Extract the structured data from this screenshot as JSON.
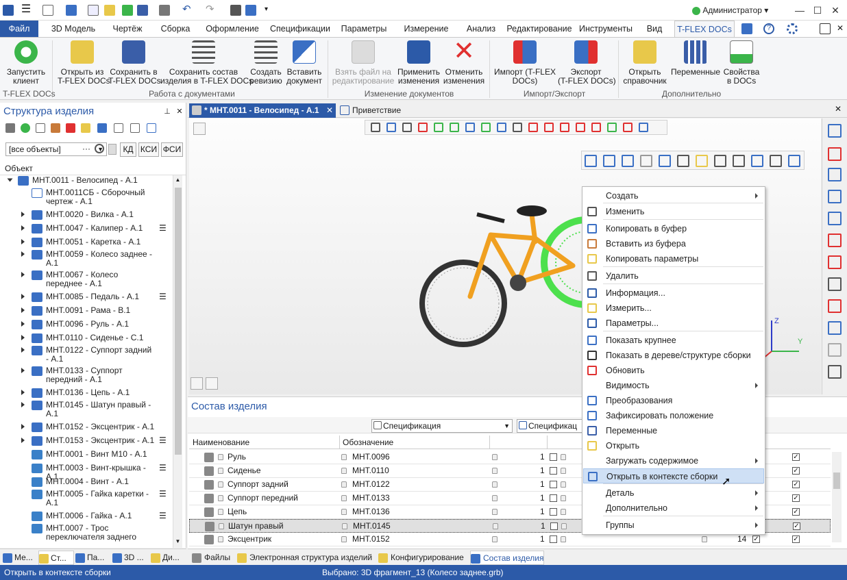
{
  "app": {
    "user": "Администратор"
  },
  "ribbon_tabs": [
    "Файл",
    "3D Модель",
    "Чертёж",
    "Сборка",
    "Оформление",
    "Спецификации",
    "Параметры",
    "Измерение",
    "Анализ",
    "Редактирование",
    "Инструменты",
    "Вид",
    "T-FLEX DOCs"
  ],
  "ribbon": {
    "buttons": [
      {
        "label1": "Запустить",
        "label2": "клиент",
        "color": "#3bb54a"
      },
      {
        "label1": "Открыть из",
        "label2": "T-FLEX DOCs",
        "color": "#e8c84a"
      },
      {
        "label1": "Сохранить в",
        "label2": "T-FLEX DOCs",
        "color": "#3a5ea8"
      },
      {
        "label1": "Сохранить состав",
        "label2": "изделия в T-FLEX DOCs",
        "color": "#555555"
      },
      {
        "label1": "Создать",
        "label2": "ревизию",
        "color": "#555555"
      },
      {
        "label1": "Вставить",
        "label2": "документ",
        "color": "#3a6fc4"
      },
      {
        "label1": "Взять файл на",
        "label2": "редактирование",
        "color": "#bbbbbb"
      },
      {
        "label1": "Применить",
        "label2": "изменения",
        "color": "#2c5aa8"
      },
      {
        "label1": "Отменить",
        "label2": "изменения",
        "color": "#e03030"
      },
      {
        "label1": "Импорт (T-FLEX",
        "label2": "DOCs)",
        "color": "#3a6fc4"
      },
      {
        "label1": "Экспорт",
        "label2": "(T-FLEX DOCs)",
        "color": "#3a6fc4"
      },
      {
        "label1": "Открыть",
        "label2": "справочник",
        "color": "#e8c84a"
      },
      {
        "label1": "Переменные",
        "label2": "",
        "color": "#3a5ea8"
      },
      {
        "label1": "Свойства",
        "label2": "в DOCs",
        "color": "#3bb54a"
      }
    ],
    "groups": [
      "T-FLEX DOCs",
      "Работа с документами",
      "Изменение документов",
      "Импорт/Экспорт",
      "Дополнительно"
    ]
  },
  "left_panel": {
    "title": "Структура изделия",
    "filter_value": "[все объекты]",
    "filter_buttons": [
      "КД",
      "КСИ",
      "ФСИ"
    ],
    "column": "Объект",
    "tree": [
      {
        "label": "МНТ.0011 - Велосипед - А.1"
      },
      {
        "label": "МНТ.0011СБ - Сборочный чертеж - А.1"
      },
      {
        "label": "МНТ.0020 - Вилка - А.1"
      },
      {
        "label": "МНТ.0047 - Калипер - А.1"
      },
      {
        "label": "МНТ.0051 - Каретка - А.1"
      },
      {
        "label": "МНТ.0059 - Колесо заднее - А.1"
      },
      {
        "label": "МНТ.0067 - Колесо переднее - А.1"
      },
      {
        "label": "МНТ.0085 - Педаль - А.1"
      },
      {
        "label": "МНТ.0091 - Рама - В.1"
      },
      {
        "label": "МНТ.0096 - Руль - А.1"
      },
      {
        "label": "МНТ.0110 - Сиденье - С.1"
      },
      {
        "label": "МНТ.0122 - Суппорт задний - А.1"
      },
      {
        "label": "МНТ.0133 - Суппорт передний - А.1"
      },
      {
        "label": "МНТ.0136 - Цепь - А.1"
      },
      {
        "label": "МНТ.0145 - Шатун правый - А.1"
      },
      {
        "label": "МНТ.0152 - Эксцентрик - А.1"
      },
      {
        "label": "МНТ.0153 - Эксцентрик - А.1"
      },
      {
        "label": "МНТ.0001 - Винт М10 - А.1"
      },
      {
        "label": "МНТ.0003 - Винт-крышка - А.1"
      },
      {
        "label": "МНТ.0004 - Винт - А.1"
      },
      {
        "label": "МНТ.0005 - Гайка каретки - А.1"
      },
      {
        "label": "МНТ.0006 - Гайка - А.1"
      },
      {
        "label": "МНТ.0007 - Трос переключателя заднего"
      }
    ]
  },
  "doc_tabs": [
    "* МНТ.0011 - Велосипед - А.1",
    "Приветствие"
  ],
  "bottom_panel": {
    "title": "Состав изделия",
    "combo1": "Спецификация",
    "combo2": "Спецификац",
    "columns": [
      "Наименование",
      "Обозначение"
    ],
    "rows": [
      {
        "name": "Руль",
        "code": "МНТ.0096",
        "qty": "1"
      },
      {
        "name": "Сиденье",
        "code": "МНТ.0110",
        "qty": "1"
      },
      {
        "name": "Суппорт задний",
        "code": "МНТ.0122",
        "qty": "1"
      },
      {
        "name": "Суппорт передний",
        "code": "МНТ.0133",
        "qty": "1"
      },
      {
        "name": "Цепь",
        "code": "МНТ.0136",
        "qty": "1"
      },
      {
        "name": "Шатун правый",
        "code": "МНТ.0145",
        "qty": "1"
      },
      {
        "name": "Эксцентрик",
        "code": "МНТ.0152",
        "qty": "1"
      }
    ],
    "last_row_right_qty": "14"
  },
  "context_menu": [
    {
      "label": "Создать",
      "sub": true,
      "icon": "none"
    },
    {
      "label": "Изменить",
      "sub": false,
      "icon": "edit-icon"
    },
    {
      "label": "Копировать в буфер",
      "sub": false,
      "icon": "copy-icon"
    },
    {
      "label": "Вставить из буфера",
      "sub": false,
      "icon": "paste-icon"
    },
    {
      "label": "Копировать параметры",
      "sub": false,
      "icon": "copy-params-icon"
    },
    {
      "label": "Удалить",
      "sub": false,
      "icon": "trash-icon"
    },
    {
      "label": "Информация...",
      "sub": false,
      "icon": "info-icon"
    },
    {
      "label": "Измерить...",
      "sub": false,
      "icon": "measure-icon"
    },
    {
      "label": "Параметры...",
      "sub": false,
      "icon": "params-icon"
    },
    {
      "label": "Показать крупнее",
      "sub": false,
      "icon": "zoom-icon"
    },
    {
      "label": "Показать в дереве/структуре сборки",
      "sub": false,
      "icon": "target-icon"
    },
    {
      "label": "Обновить",
      "sub": false,
      "icon": "refresh-icon"
    },
    {
      "label": "Видимость",
      "sub": true,
      "icon": "none"
    },
    {
      "label": "Преобразования",
      "sub": false,
      "icon": "transform-icon"
    },
    {
      "label": "Зафиксировать положение",
      "sub": false,
      "icon": "pin-icon"
    },
    {
      "label": "Переменные",
      "sub": false,
      "icon": "variables-icon"
    },
    {
      "label": "Открыть",
      "sub": false,
      "icon": "folder-icon"
    },
    {
      "label": "Загружать содержимое",
      "sub": true,
      "icon": "none"
    },
    {
      "label": "Открыть в контексте сборки",
      "sub": false,
      "icon": "context-icon"
    },
    {
      "label": "Деталь",
      "sub": true,
      "icon": "none"
    },
    {
      "label": "Дополнительно",
      "sub": true,
      "icon": "none"
    },
    {
      "label": "Группы",
      "sub": true,
      "icon": "none"
    }
  ],
  "bottom_tabs_left": [
    "Ме...",
    "Ст...",
    "Па...",
    "3D ...",
    "Ди..."
  ],
  "bottom_tabs_right": [
    "Файлы",
    "Электронная структура изделий",
    "Конфигурирование",
    "Состав изделия"
  ],
  "status": {
    "left": "Открыть в контексте сборки",
    "center": "Выбрано: 3D фрагмент_13 (Колесо заднее.grb)"
  },
  "axis_labels": {
    "y": "Y",
    "z": "Z"
  }
}
